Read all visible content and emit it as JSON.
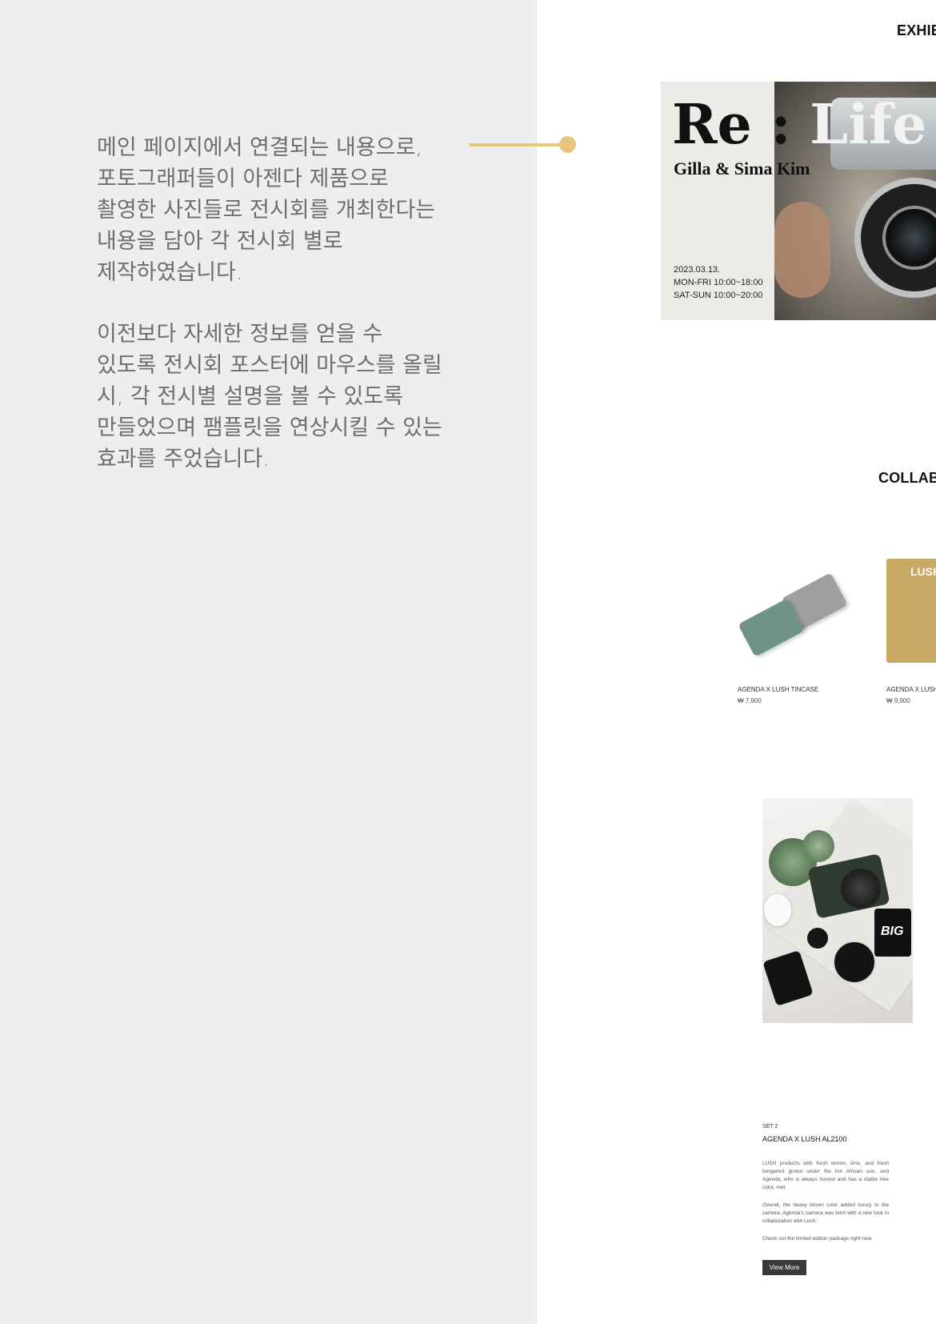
{
  "annotation": {
    "paragraph_1": "메인 페이지에서 연결되는 내용으로, 포토그래퍼들이 아젠다 제품으로 촬영한 사진들로 전시회를 개최한다는 내용을 담아 각 전시회 별로 제작하였습니다.",
    "paragraph_2": "이전보다 자세한 정보를 얻을 수 있도록 전시회 포스터에 마우스를 올릴 시, 각 전시별 설명을 볼 수 있도록 만들었으며 팸플릿을 연상시킬 수 있는 효과를 주었습니다.",
    "connector_color": "#e9c680"
  },
  "exhibition": {
    "section_title": "EXHIB",
    "poster": {
      "title_dark": "Re :",
      "title_light": "Life",
      "subtitle": "Gilla & Sima Kim",
      "date": "2023.03.13.",
      "hours_weekday": "MON-FRI 10:00~18:00",
      "hours_weekend": "SAT-SUN 10:00~20:00"
    }
  },
  "collaboration": {
    "section_title": "COLLABO",
    "products": [
      {
        "name": "AGENDA X LUSH TINCASE",
        "price": "₩ 7,900"
      },
      {
        "name": "AGENDA X LUSH C",
        "price": "₩ 9,900",
        "image_label": "LUSH"
      }
    ]
  },
  "set": {
    "number": "SET 2",
    "name": "AGENDA X LUSH AL2100",
    "paragraph_1": "LUSH products with fresh lemon, lime, and fresh bergamot grown under the hot African sun, and Agenda, who is always honest and has a stable tree color, met.",
    "paragraph_2": "Overall, the heavy brown color added luxury to the camera. Agenda's camera was born with a new look in collaboration with Lush.",
    "paragraph_3": "Check out the limited edition package right now.",
    "button_label": "View More",
    "jar_label": "BIG"
  }
}
